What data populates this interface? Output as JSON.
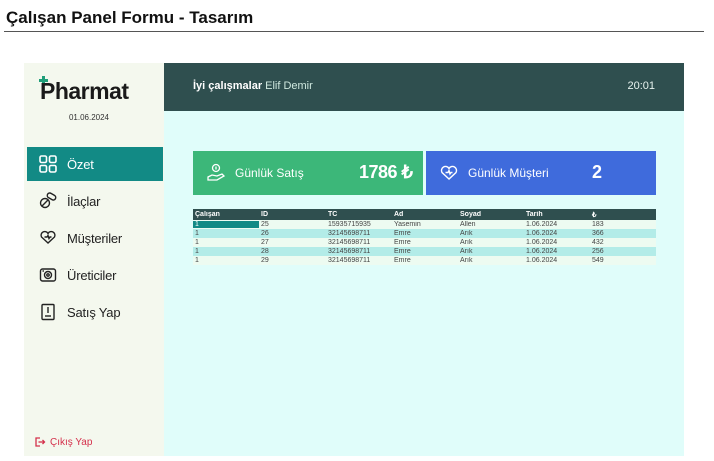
{
  "document": {
    "title": "Çalışan Panel Formu - Tasarım"
  },
  "sidebar": {
    "logo": "Pharmat",
    "date": "01.06.2024",
    "items": [
      {
        "label": "Özet",
        "icon": "grid-icon",
        "active": true
      },
      {
        "label": "İlaçlar",
        "icon": "pills-icon",
        "active": false
      },
      {
        "label": "Müşteriler",
        "icon": "heart-hand-icon",
        "active": false
      },
      {
        "label": "Üreticiler",
        "icon": "factory-icon",
        "active": false
      },
      {
        "label": "Satış Yap",
        "icon": "receipt-icon",
        "active": false
      }
    ],
    "logout": "Çıkış Yap"
  },
  "header": {
    "greeting": "İyi çalışmalar",
    "user": "Elif Demir",
    "time": "20:01"
  },
  "cards": {
    "sales": {
      "label": "Günlük Satış",
      "value": "1786 ₺",
      "icon": "money-hand-icon",
      "color": "#3cb779"
    },
    "customers": {
      "label": "Günlük Müşteri",
      "value": "2",
      "icon": "heart-hand-icon",
      "color": "#3f6bdc"
    }
  },
  "table": {
    "columns": [
      "Çalışan",
      "ID",
      "TC",
      "Ad",
      "Soyad",
      "Tarih",
      "₺"
    ],
    "rows": [
      [
        "1",
        "25",
        "15935715935",
        "Yasemin",
        "Allen",
        "1.06.2024",
        "183"
      ],
      [
        "1",
        "26",
        "32145698711",
        "Emre",
        "Arık",
        "1.06.2024",
        "366"
      ],
      [
        "1",
        "27",
        "32145698711",
        "Emre",
        "Arık",
        "1.06.2024",
        "432"
      ],
      [
        "1",
        "28",
        "32145698711",
        "Emre",
        "Arık",
        "1.06.2024",
        "256"
      ],
      [
        "1",
        "29",
        "32145698711",
        "Emre",
        "Arık",
        "1.06.2024",
        "549"
      ]
    ]
  },
  "colors": {
    "header": "#2f4f4f",
    "active_nav": "#128a85",
    "content_bg": "#e0fdfa",
    "logout": "#d4304b"
  }
}
